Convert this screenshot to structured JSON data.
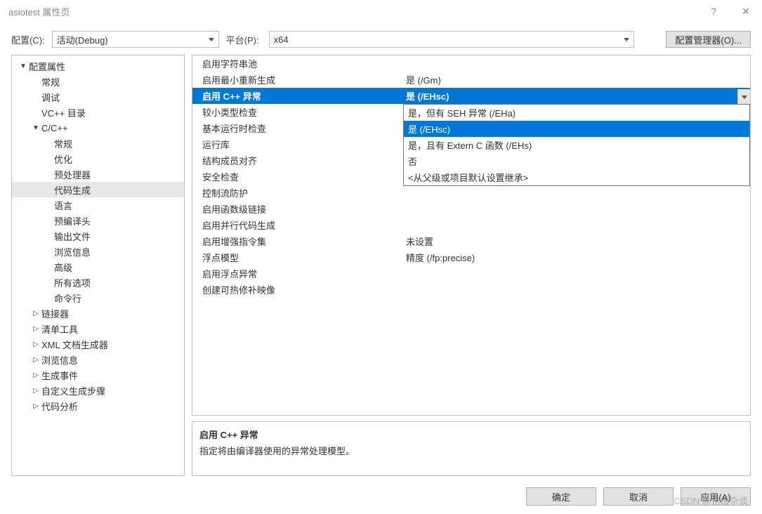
{
  "window": {
    "title": "asiotest 属性页"
  },
  "toolbar": {
    "config_label": "配置(C):",
    "config_value": "活动(Debug)",
    "platform_label": "平台(P):",
    "platform_value": "x64",
    "manager_button": "配置管理器(O)..."
  },
  "tree": [
    {
      "label": "配置属性",
      "indent": 0,
      "arrow": "▼"
    },
    {
      "label": "常规",
      "indent": 1,
      "arrow": ""
    },
    {
      "label": "调试",
      "indent": 1,
      "arrow": ""
    },
    {
      "label": "VC++ 目录",
      "indent": 1,
      "arrow": ""
    },
    {
      "label": "C/C++",
      "indent": 1,
      "arrow": "▼"
    },
    {
      "label": "常规",
      "indent": 2,
      "arrow": ""
    },
    {
      "label": "优化",
      "indent": 2,
      "arrow": ""
    },
    {
      "label": "预处理器",
      "indent": 2,
      "arrow": ""
    },
    {
      "label": "代码生成",
      "indent": 2,
      "arrow": "",
      "sel": true
    },
    {
      "label": "语言",
      "indent": 2,
      "arrow": ""
    },
    {
      "label": "预编译头",
      "indent": 2,
      "arrow": ""
    },
    {
      "label": "输出文件",
      "indent": 2,
      "arrow": ""
    },
    {
      "label": "浏览信息",
      "indent": 2,
      "arrow": ""
    },
    {
      "label": "高级",
      "indent": 2,
      "arrow": ""
    },
    {
      "label": "所有选项",
      "indent": 2,
      "arrow": ""
    },
    {
      "label": "命令行",
      "indent": 2,
      "arrow": ""
    },
    {
      "label": "链接器",
      "indent": 1,
      "arrow": "▷"
    },
    {
      "label": "清单工具",
      "indent": 1,
      "arrow": "▷"
    },
    {
      "label": "XML 文档生成器",
      "indent": 1,
      "arrow": "▷"
    },
    {
      "label": "浏览信息",
      "indent": 1,
      "arrow": "▷"
    },
    {
      "label": "生成事件",
      "indent": 1,
      "arrow": "▷"
    },
    {
      "label": "自定义生成步骤",
      "indent": 1,
      "arrow": "▷"
    },
    {
      "label": "代码分析",
      "indent": 1,
      "arrow": "▷"
    }
  ],
  "props": [
    {
      "name": "启用字符串池",
      "value": ""
    },
    {
      "name": "启用最小重新生成",
      "value": "是 (/Gm)"
    },
    {
      "name": "启用 C++ 异常",
      "value": "是 (/EHsc)",
      "sel": true
    },
    {
      "name": "较小类型检查",
      "value": ""
    },
    {
      "name": "基本运行时检查",
      "value": ""
    },
    {
      "name": "运行库",
      "value": ""
    },
    {
      "name": "结构成员对齐",
      "value": ""
    },
    {
      "name": "安全检查",
      "value": ""
    },
    {
      "name": "控制流防护",
      "value": ""
    },
    {
      "name": "启用函数级链接",
      "value": ""
    },
    {
      "name": "启用并行代码生成",
      "value": ""
    },
    {
      "name": "启用增强指令集",
      "value": "未设置"
    },
    {
      "name": "浮点模型",
      "value": "精度 (/fp:precise)"
    },
    {
      "name": "启用浮点异常",
      "value": ""
    },
    {
      "name": "创建可热修补映像",
      "value": ""
    }
  ],
  "dropdown": {
    "options": [
      {
        "label": "是，但有 SEH 异常 (/EHa)"
      },
      {
        "label": "是 (/EHsc)",
        "sel": true
      },
      {
        "label": "是，且有 Extern C 函数 (/EHs)"
      },
      {
        "label": "否"
      },
      {
        "label": "<从父级或项目默认设置继承>"
      }
    ]
  },
  "description": {
    "title": "启用 C++ 异常",
    "text": "指定将由编译器使用的异常处理模型。"
  },
  "footer": {
    "ok": "确定",
    "cancel": "取消",
    "apply": "应用(A)"
  },
  "watermark": "CSDN @倍缓杂谈"
}
